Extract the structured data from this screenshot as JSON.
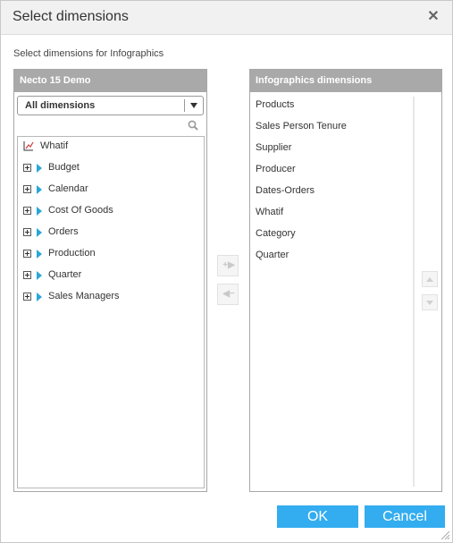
{
  "dialog": {
    "title": "Select dimensions",
    "close_icon": "close-icon",
    "subtitle": "Select dimensions for Infographics"
  },
  "left_panel": {
    "header": "Necto 15 Demo",
    "filter": {
      "selected": "All dimensions"
    },
    "search_icon": "search-icon",
    "tree": [
      {
        "label": "Whatif",
        "icon": "whatif-icon"
      },
      {
        "label": "Budget"
      },
      {
        "label": "Calendar"
      },
      {
        "label": "Cost Of Goods"
      },
      {
        "label": "Orders"
      },
      {
        "label": "Production"
      },
      {
        "label": "Quarter"
      },
      {
        "label": "Sales Managers"
      }
    ]
  },
  "transfer": {
    "add_icon": "add-arrow-icon",
    "remove_icon": "remove-arrow-icon"
  },
  "right_panel": {
    "header": "Infographics dimensions",
    "items": [
      "Products",
      "Sales Person Tenure",
      "Supplier",
      "Producer",
      "Dates-Orders",
      "Whatif",
      "Category",
      "Quarter"
    ],
    "move_up_icon": "move-up-icon",
    "move_down_icon": "move-down-icon"
  },
  "footer": {
    "ok_label": "OK",
    "cancel_label": "Cancel"
  },
  "colors": {
    "accent": "#33adf0",
    "panel_header": "#a9a9a9",
    "tree_triangle": "#2aa7d8"
  }
}
